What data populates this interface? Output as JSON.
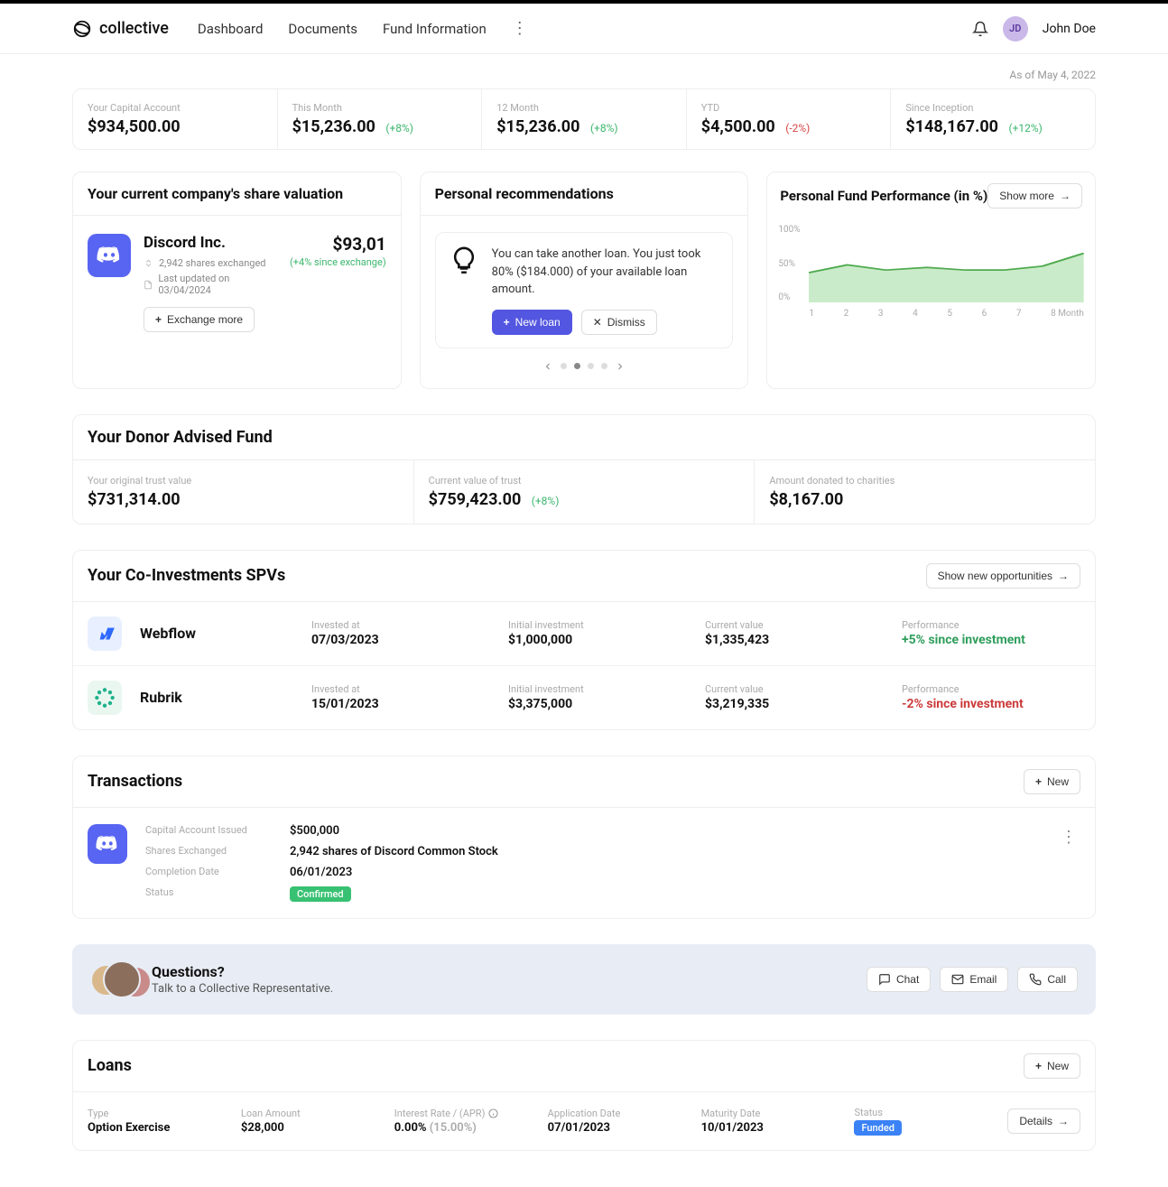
{
  "brand": "collective",
  "nav": {
    "dashboard": "Dashboard",
    "documents": "Documents",
    "fund": "Fund Information"
  },
  "user": {
    "initials": "JD",
    "name": "John Doe"
  },
  "asOf": "As of May 4, 2022",
  "stats": {
    "capital": {
      "label": "Your Capital Account",
      "value": "$934,500.00"
    },
    "month": {
      "label": "This Month",
      "value": "$15,236.00",
      "delta": "(+8%)",
      "dir": "pos"
    },
    "twelve": {
      "label": "12 Month",
      "value": "$15,236.00",
      "delta": "(+8%)",
      "dir": "pos"
    },
    "ytd": {
      "label": "YTD",
      "value": "$4,500.00",
      "delta": "(-2%)",
      "dir": "neg"
    },
    "inception": {
      "label": "Since Inception",
      "value": "$148,167.00",
      "delta": "(+12%)",
      "dir": "pos"
    }
  },
  "valuation": {
    "title": "Your current company's share valuation",
    "company": "Discord Inc.",
    "shares": "2,942 shares exchanged",
    "updated": "Last updated on 03/04/2024",
    "exchangeBtn": "Exchange more",
    "price": "$93,01",
    "priceDelta": "(+4% since exchange)"
  },
  "reco": {
    "title": "Personal recommendations",
    "text": "You can take another loan. You just took 80% ($184.000) of your available loan amount.",
    "newLoan": "New loan",
    "dismiss": "Dismiss"
  },
  "perf": {
    "title": "Personal Fund Performance (in %)",
    "showMore": "Show more",
    "yTicks": [
      "100%",
      "50%",
      "0%"
    ],
    "xTicks": [
      "1",
      "2",
      "3",
      "4",
      "5",
      "6",
      "7",
      "8"
    ],
    "xAxisSuffix": "Month"
  },
  "chart_data": {
    "type": "area",
    "title": "Personal Fund Performance (in %)",
    "xlabel": "Month",
    "ylabel": "%",
    "ylim": [
      0,
      100
    ],
    "x": [
      1,
      2,
      3,
      4,
      5,
      6,
      7,
      8
    ],
    "values": [
      38,
      48,
      42,
      44,
      41,
      42,
      47,
      63
    ]
  },
  "daf": {
    "title": "Your Donor Advised Fund",
    "original": {
      "label": "Your original trust value",
      "value": "$731,314.00"
    },
    "current": {
      "label": "Current value of trust",
      "value": "$759,423.00",
      "delta": "(+8%)"
    },
    "donated": {
      "label": "Amount donated to charities",
      "value": "$8,167.00"
    }
  },
  "spv": {
    "title": "Your Co-Investments SPVs",
    "cta": "Show new opportunities",
    "cols": {
      "invested": "Invested at",
      "initial": "Initial investment",
      "current": "Current value",
      "perf": "Performance"
    },
    "rows": [
      {
        "name": "Webflow",
        "invested": "07/03/2023",
        "initial": "$1,000,000",
        "current": "$1,335,423",
        "perf": "+5% since investment",
        "dir": "pos"
      },
      {
        "name": "Rubrik",
        "invested": "15/01/2023",
        "initial": "$3,375,000",
        "current": "$3,219,335",
        "perf": "-2% since investment",
        "dir": "neg"
      }
    ]
  },
  "trans": {
    "title": "Transactions",
    "new": "New",
    "labels": {
      "issued": "Capital Account Issued",
      "shares": "Shares Exchanged",
      "date": "Completion Date",
      "status": "Status"
    },
    "values": {
      "issued": "$500,000",
      "shares": "2,942 shares of Discord Common Stock",
      "date": "06/01/2023",
      "status": "Confirmed"
    }
  },
  "questions": {
    "title": "Questions?",
    "sub": "Talk to a Collective Representative.",
    "chat": "Chat",
    "email": "Email",
    "call": "Call"
  },
  "loans": {
    "title": "Loans",
    "new": "New",
    "labels": {
      "type": "Type",
      "amount": "Loan Amount",
      "rate": "Interest Rate / (APR)",
      "app": "Application Date",
      "mat": "Maturity Date",
      "status": "Status"
    },
    "row": {
      "type": "Option Exercise",
      "amount": "$28,000",
      "rate": "0.00%",
      "apr": "(15.00%)",
      "app": "07/01/2023",
      "mat": "10/01/2023",
      "status": "Funded"
    },
    "details": "Details"
  }
}
